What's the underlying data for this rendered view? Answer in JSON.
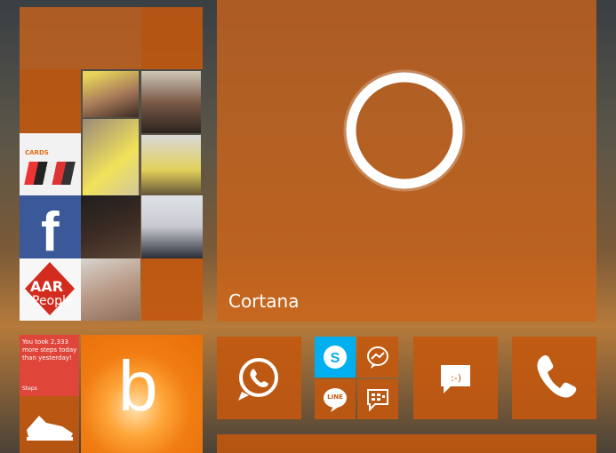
{
  "tiles": {
    "cortana": {
      "label": "Cortana"
    },
    "cards": {
      "label": "CARDS"
    },
    "aar": {
      "line1": "AAR",
      "line2": "People"
    },
    "fitness": {
      "message": "You took 2,333 more steps today than yesterday!",
      "footer": "Steps"
    },
    "facebook": {
      "glyph": "f"
    },
    "bing": {
      "glyph": "b"
    },
    "line": {
      "label": "LINE"
    }
  },
  "colors": {
    "accent": "#c4580e",
    "facebook": "#3b5998",
    "skype": "#00aff0",
    "fitness": "#e0453a",
    "bing": "#f07d12"
  },
  "icons": [
    "whatsapp-icon",
    "skype-icon",
    "messenger-icon",
    "line-icon",
    "bbm-icon",
    "messaging-icon",
    "phone-icon",
    "cortana-ring-icon",
    "running-shoe-icon"
  ]
}
